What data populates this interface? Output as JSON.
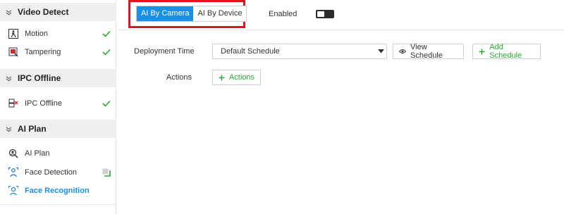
{
  "sidebar": {
    "sections": [
      {
        "title": "Video Detect",
        "items": [
          {
            "label": "Motion",
            "status": "check"
          },
          {
            "label": "Tampering",
            "status": "check"
          }
        ]
      },
      {
        "title": "IPC Offline",
        "items": [
          {
            "label": "IPC Offline",
            "status": "check"
          }
        ]
      },
      {
        "title": "AI Plan",
        "items": [
          {
            "label": "AI Plan",
            "status": "none"
          },
          {
            "label": "Face Detection",
            "status": "partial"
          },
          {
            "label": "Face Recognition",
            "status": "active"
          }
        ]
      }
    ]
  },
  "tabs": {
    "items": [
      {
        "label": "AI By Camera",
        "selected": true
      },
      {
        "label": "AI By Device",
        "selected": false
      }
    ]
  },
  "enabled": {
    "label": "Enabled",
    "state": "on"
  },
  "form": {
    "deployment_time_label": "Deployment Time",
    "deployment_time_value": "Default Schedule",
    "view_schedule_label": "View Schedule",
    "add_schedule_label": "Add Schedule",
    "actions_label": "Actions",
    "actions_button_label": "Actions"
  },
  "colors": {
    "accent": "#1a8fe3",
    "success": "#2aa832",
    "highlight_frame": "#e0141e"
  }
}
